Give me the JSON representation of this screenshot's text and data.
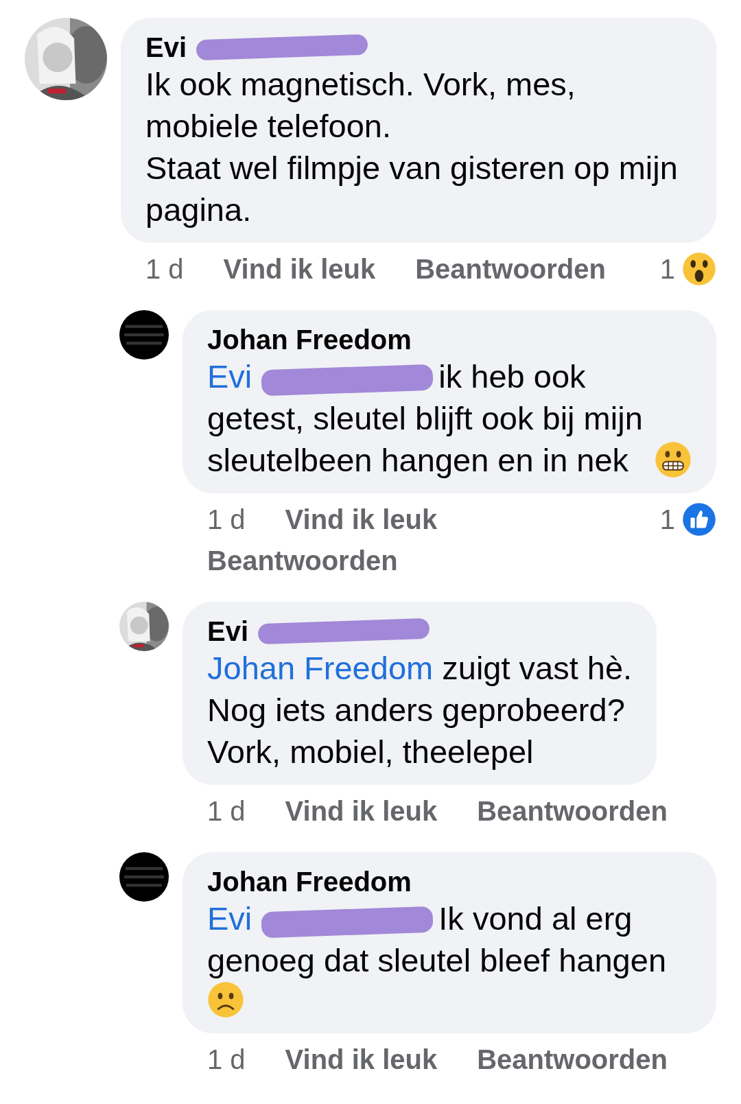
{
  "comments": [
    {
      "reply": false,
      "name": "Evi",
      "redacted": true,
      "text": "Ik ook magnetisch. Vork, mes, mobiele telefoon.\nStaat wel filmpje van gisteren op mijn pagina.",
      "time": "1 d",
      "like": "Vind ik leuk",
      "answer": "Beantwoorden",
      "reaction": {
        "count": "1",
        "kind": "wow"
      }
    },
    {
      "reply": true,
      "avatar": {
        "kind": "black"
      },
      "name": "Johan Freedom",
      "mention": "Evi",
      "mention_redacted": true,
      "text": "ik heb ook getest, sleutel blijft ook bij mijn sleutelbeen hangen en in nek",
      "emoji": {
        "kind": "grimace"
      },
      "time": "1 d",
      "like": "Vind ik leuk",
      "answer": "Beantwoorden",
      "reaction": {
        "count": "1",
        "kind": "like"
      }
    },
    {
      "reply": true,
      "name": "Evi",
      "redacted": true,
      "mention": "Johan Freedom",
      "text": "zuigt vast hè.\nNog iets anders geprobeerd?\nVork, mobiel, theelepel",
      "time": "1 d",
      "like": "Vind ik leuk",
      "answer": "Beantwoorden"
    },
    {
      "reply": true,
      "avatar": {
        "kind": "black"
      },
      "name": "Johan Freedom",
      "mention": "Evi",
      "mention_redacted": true,
      "text": "Ik vond al erg genoeg dat sleutel bleef hangen",
      "emoji": {
        "kind": "frown"
      },
      "time": "1 d",
      "like": "Vind ik leuk",
      "answer": "Beantwoorden"
    }
  ]
}
